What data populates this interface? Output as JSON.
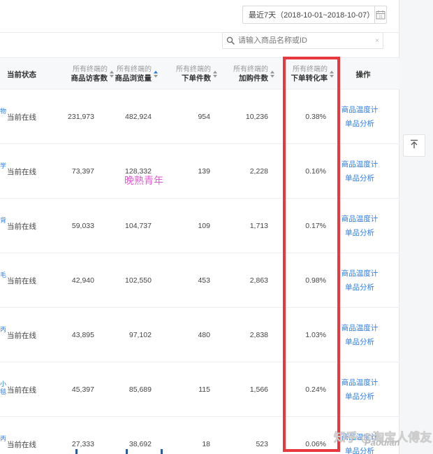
{
  "date_range": {
    "label": "最近7天（2018-10-01~2018-10-07）",
    "calendar_icon": "calendar-icon",
    "calendar_num": "31"
  },
  "search": {
    "placeholder": "请输入商品名称或ID",
    "icon": "search-icon",
    "clear": "×"
  },
  "table": {
    "status_header": "当前状态",
    "metric_headers": [
      {
        "line1": "所有终端的",
        "line2": "商品访客数"
      },
      {
        "line1": "所有终端的",
        "line2": "商品浏览量"
      },
      {
        "line1": "所有终端的",
        "line2": "下单件数"
      },
      {
        "line1": "所有终端的",
        "line2": "加购件数"
      },
      {
        "line1": "所有终端的",
        "line2": "下单转化率"
      }
    ],
    "action_header": "操作",
    "rows": [
      {
        "edge": "物",
        "status": "当前在线",
        "visitors": "231,973",
        "views": "482,924",
        "orders": "954",
        "carts": "10,236",
        "rate": "0.38%",
        "action1": "商品温度计",
        "action2": "单品分析"
      },
      {
        "edge": "学",
        "status": "当前在线",
        "visitors": "73,397",
        "views": "128,332",
        "orders": "139",
        "carts": "2,228",
        "rate": "0.16%",
        "action1": "商品温度计",
        "action2": "单品分析"
      },
      {
        "edge": "背",
        "status": "当前在线",
        "visitors": "59,033",
        "views": "104,737",
        "orders": "109",
        "carts": "1,713",
        "rate": "0.17%",
        "action1": "商品温度计",
        "action2": "单品分析"
      },
      {
        "edge": "毛",
        "status": "当前在线",
        "visitors": "42,940",
        "views": "102,550",
        "orders": "453",
        "carts": "2,863",
        "rate": "0.98%",
        "action1": "商品温度计",
        "action2": "单品分析"
      },
      {
        "edge": "丙",
        "status": "当前在线",
        "visitors": "43,895",
        "views": "97,102",
        "orders": "480",
        "carts": "2,838",
        "rate": "1.03%",
        "action1": "商品温度计",
        "action2": "单品分析"
      },
      {
        "edge": "小\n毯",
        "status": "当前在线",
        "visitors": "45,397",
        "views": "85,689",
        "orders": "115",
        "carts": "1,566",
        "rate": "0.24%",
        "action1": "商品温度计",
        "action2": "单品分析"
      },
      {
        "edge": "丙",
        "status": "当前在线",
        "visitors": "27,333",
        "views": "38,692",
        "orders": "18",
        "carts": "523",
        "rate": "0.06%",
        "action1": "商品温度计",
        "action2": "单品分析"
      }
    ]
  },
  "watermarks": {
    "pink": "晚熟青年",
    "zhihu": "知乎 @淘宝人傅友",
    "corner": "Paodian"
  },
  "colors": {
    "link": "#2d7ee6",
    "highlight": "#e8383d",
    "header_bg": "#f7f8fa"
  },
  "back_to_top_icon": "arrow-up-to-top-icon"
}
